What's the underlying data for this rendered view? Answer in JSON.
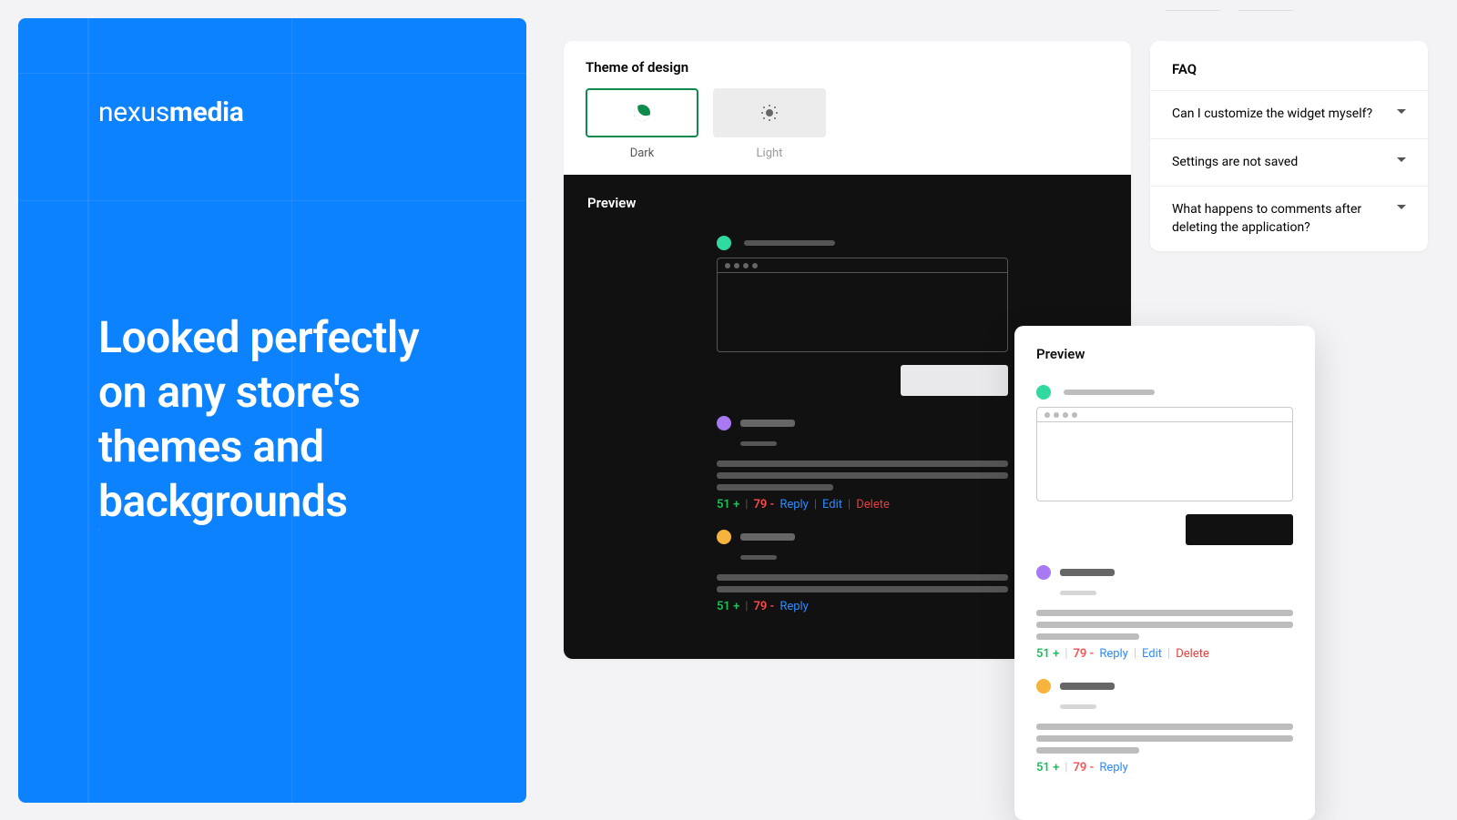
{
  "hero": {
    "brand_light": "nexus",
    "brand_bold": "media",
    "headline": "Looked perfectly on any store's themes and backgrounds"
  },
  "theme": {
    "section_title": "Theme of design",
    "dark_label": "Dark",
    "light_label": "Light"
  },
  "preview": {
    "title": "Preview",
    "upvotes": "51",
    "upvote_symbol": "+",
    "downvotes": "79",
    "downvote_symbol": "-",
    "reply": "Reply",
    "edit": "Edit",
    "delete": "Delete"
  },
  "faq": {
    "title": "FAQ",
    "items": [
      "Can I customize the widget myself?",
      "Settings are not saved",
      "What happens to comments after deleting the application?"
    ]
  }
}
